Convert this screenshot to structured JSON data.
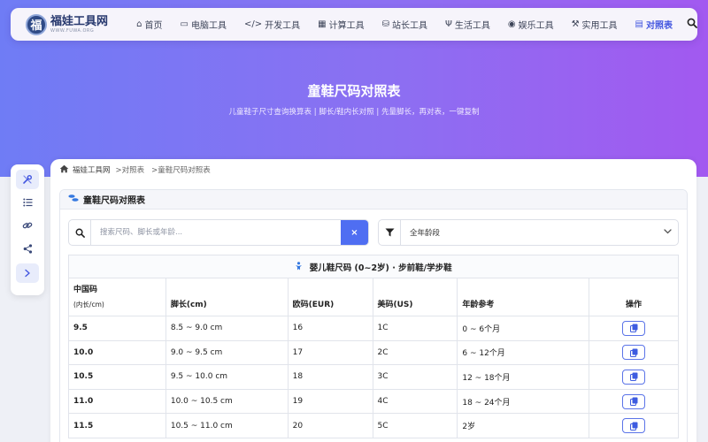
{
  "site": {
    "logo_char": "福",
    "name": "福娃工具网",
    "domain": "WWW.FUWA.ORG"
  },
  "nav": {
    "items": [
      {
        "icon": "home-icon",
        "glyph": "⌂",
        "label": "首页"
      },
      {
        "icon": "computer-icon",
        "glyph": "▭",
        "label": "电脑工具"
      },
      {
        "icon": "code-icon",
        "glyph": "</>",
        "label": "开发工具"
      },
      {
        "icon": "calculator-icon",
        "glyph": "▦",
        "label": "计算工具"
      },
      {
        "icon": "webmaster-icon",
        "glyph": "⛁",
        "label": "站长工具"
      },
      {
        "icon": "utensils-icon",
        "glyph": "Ψ",
        "label": "生活工具"
      },
      {
        "icon": "gamepad-icon",
        "glyph": "◉",
        "label": "娱乐工具"
      },
      {
        "icon": "wrench-icon",
        "glyph": "⚒",
        "label": "实用工具"
      },
      {
        "icon": "table-icon",
        "glyph": "▤",
        "label": "对照表",
        "active": true
      }
    ]
  },
  "hero": {
    "title": "童鞋尺码对照表",
    "subtitle": "儿童鞋子尺寸查询换算表 | 脚长/鞋内长对照 | 先量脚长，再对表，一键复制"
  },
  "breadcrumb": {
    "home": "福娃工具网",
    "level1": ">对照表",
    "level2": ">童鞋尺码对照表"
  },
  "card": {
    "title": "童鞋尺码对照表"
  },
  "search": {
    "placeholder": "搜索尺码、脚长或年龄...",
    "clear_label": "×"
  },
  "age_filter": {
    "selected": "全年龄段"
  },
  "table": {
    "caption": "婴儿鞋尺码 (0~2岁) · 步前鞋/学步鞋",
    "headers": {
      "cn": "中国码",
      "cn_sub": "(内长/cm)",
      "foot": "脚长(cm)",
      "eur": "欧码(EUR)",
      "us": "美码(US)",
      "age": "年龄参考",
      "op": "操作"
    },
    "rows": [
      {
        "cn": "9.5",
        "foot": "8.5 ~ 9.0 cm",
        "eur": "16",
        "us": "1C",
        "age": "0 ~ 6个月"
      },
      {
        "cn": "10.0",
        "foot": "9.0 ~ 9.5 cm",
        "eur": "17",
        "us": "2C",
        "age": "6 ~ 12个月"
      },
      {
        "cn": "10.5",
        "foot": "9.5 ~ 10.0 cm",
        "eur": "18",
        "us": "3C",
        "age": "12 ~ 18个月"
      },
      {
        "cn": "11.0",
        "foot": "10.0 ~ 10.5 cm",
        "eur": "19",
        "us": "4C",
        "age": "18 ~ 24个月"
      },
      {
        "cn": "11.5",
        "foot": "10.5 ~ 11.0 cm",
        "eur": "20",
        "us": "5C",
        "age": "2岁"
      }
    ]
  }
}
